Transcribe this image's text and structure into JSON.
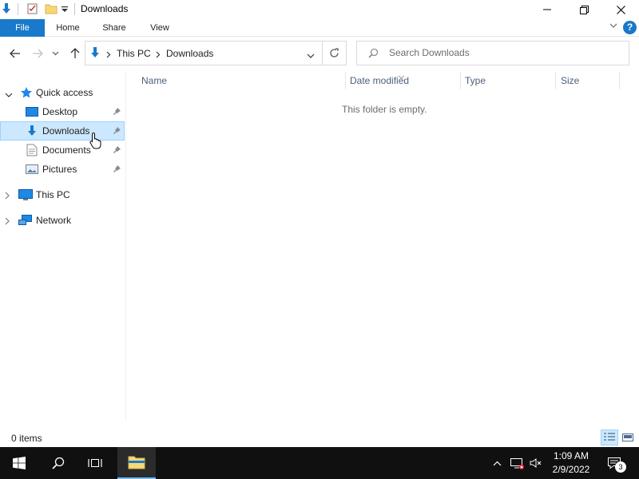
{
  "window": {
    "title": "Downloads"
  },
  "ribbon": {
    "tabs": [
      "File",
      "Home",
      "Share",
      "View"
    ],
    "help_label": "?"
  },
  "address": {
    "crumbs": [
      "This PC",
      "Downloads"
    ]
  },
  "search": {
    "placeholder": "Search Downloads"
  },
  "nav": {
    "quick_access": "Quick access",
    "items": [
      {
        "label": "Desktop",
        "icon": "desktop-icon",
        "pinned": true
      },
      {
        "label": "Downloads",
        "icon": "downloads-icon",
        "pinned": true,
        "selected": true
      },
      {
        "label": "Documents",
        "icon": "documents-icon",
        "pinned": true
      },
      {
        "label": "Pictures",
        "icon": "pictures-icon",
        "pinned": true
      }
    ],
    "this_pc": "This PC",
    "network": "Network"
  },
  "content": {
    "columns": [
      "Name",
      "Date modified",
      "Type",
      "Size"
    ],
    "empty_message": "This folder is empty."
  },
  "status": {
    "item_count": "0 items"
  },
  "taskbar": {
    "time": "1:09 AM",
    "date": "2/9/2022",
    "notification_count": "3"
  },
  "colors": {
    "accent": "#1979ca",
    "selection": "#cce8ff",
    "taskbar": "#101010"
  }
}
